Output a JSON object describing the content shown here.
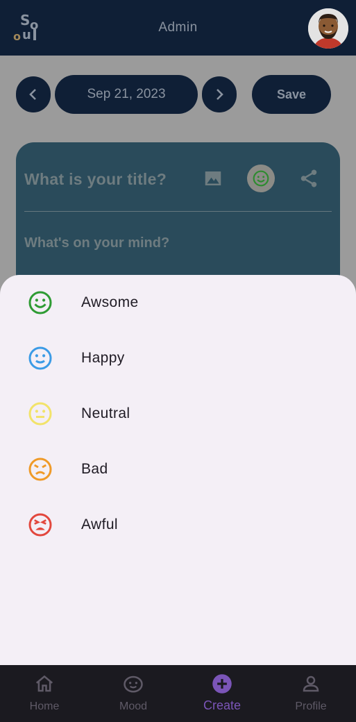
{
  "appbar": {
    "title": "Admin",
    "logo_text": "Soul"
  },
  "toolbar": {
    "date": "Sep 21, 2023",
    "save_label": "Save"
  },
  "editor": {
    "title_placeholder": "What is your title?",
    "body_placeholder": "What's on your mind?"
  },
  "mood_sheet": {
    "items": [
      {
        "label": "Awsome",
        "icon": "very-satisfied-icon",
        "color": "#2e9b33"
      },
      {
        "label": "Happy",
        "icon": "satisfied-icon",
        "color": "#3b9be6"
      },
      {
        "label": "Neutral",
        "icon": "neutral-icon",
        "color": "#f2e36a"
      },
      {
        "label": "Bad",
        "icon": "dissatisfied-icon",
        "color": "#ef9a28"
      },
      {
        "label": "Awful",
        "icon": "very-dissatisfied-icon",
        "color": "#e2473d"
      }
    ]
  },
  "bottom_nav": {
    "tabs": [
      {
        "label": "Home",
        "icon": "home-icon"
      },
      {
        "label": "Mood",
        "icon": "mood-icon"
      },
      {
        "label": "Create",
        "icon": "add-circle-icon",
        "active": true
      },
      {
        "label": "Profile",
        "icon": "person-icon"
      }
    ]
  }
}
